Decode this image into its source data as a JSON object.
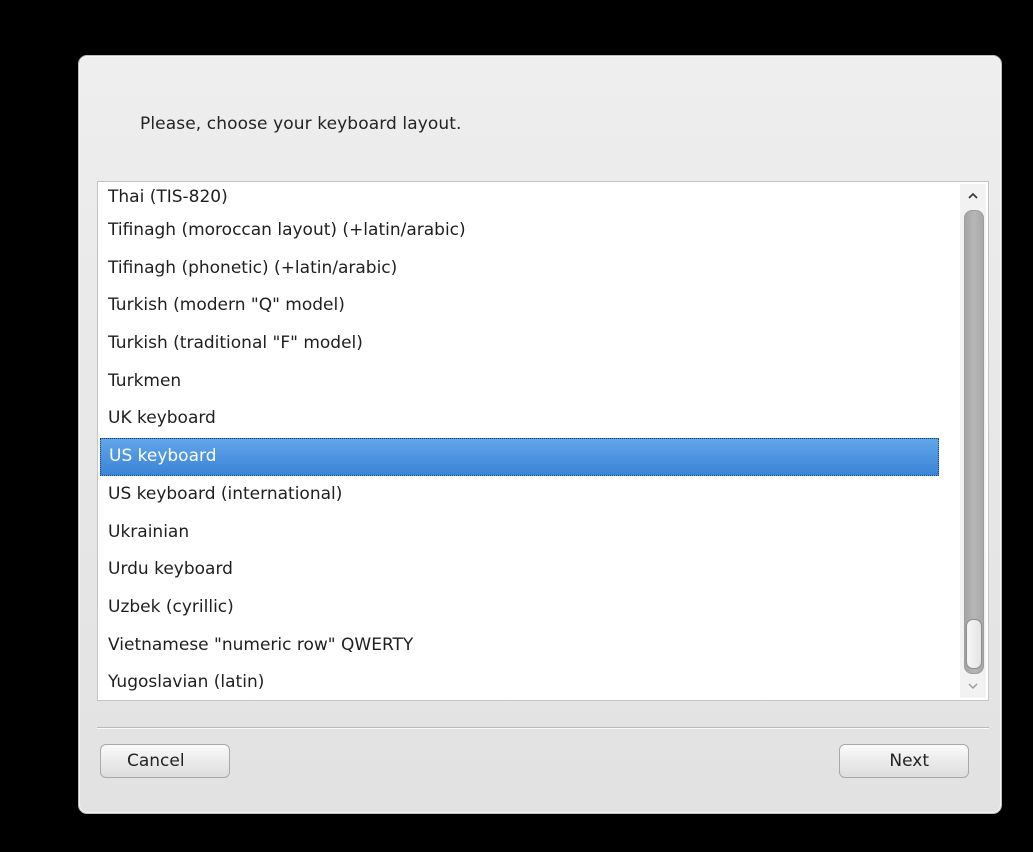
{
  "dialog": {
    "prompt": "Please, choose your keyboard layout."
  },
  "layout_list": {
    "items": [
      "Thai (TIS-820)",
      "Tifinagh (moroccan layout) (+latin/arabic)",
      "Tifinagh (phonetic) (+latin/arabic)",
      "Turkish (modern \"Q\" model)",
      "Turkish (traditional \"F\" model)",
      "Turkmen",
      "UK keyboard",
      "US keyboard",
      "US keyboard (international)",
      "Ukrainian",
      "Urdu keyboard",
      "Uzbek (cyrillic)",
      "Vietnamese \"numeric row\" QWERTY",
      "Yugoslavian (latin)"
    ],
    "selected": "US keyboard",
    "scroll_up_icon": "chevron-up-icon",
    "scroll_down_icon": "chevron-down-icon"
  },
  "buttons": {
    "cancel_label": "Cancel",
    "next_label": "Next"
  },
  "colors": {
    "selection": "#3d88d9",
    "background": "#000000",
    "dialog": "#e8e8e8"
  }
}
